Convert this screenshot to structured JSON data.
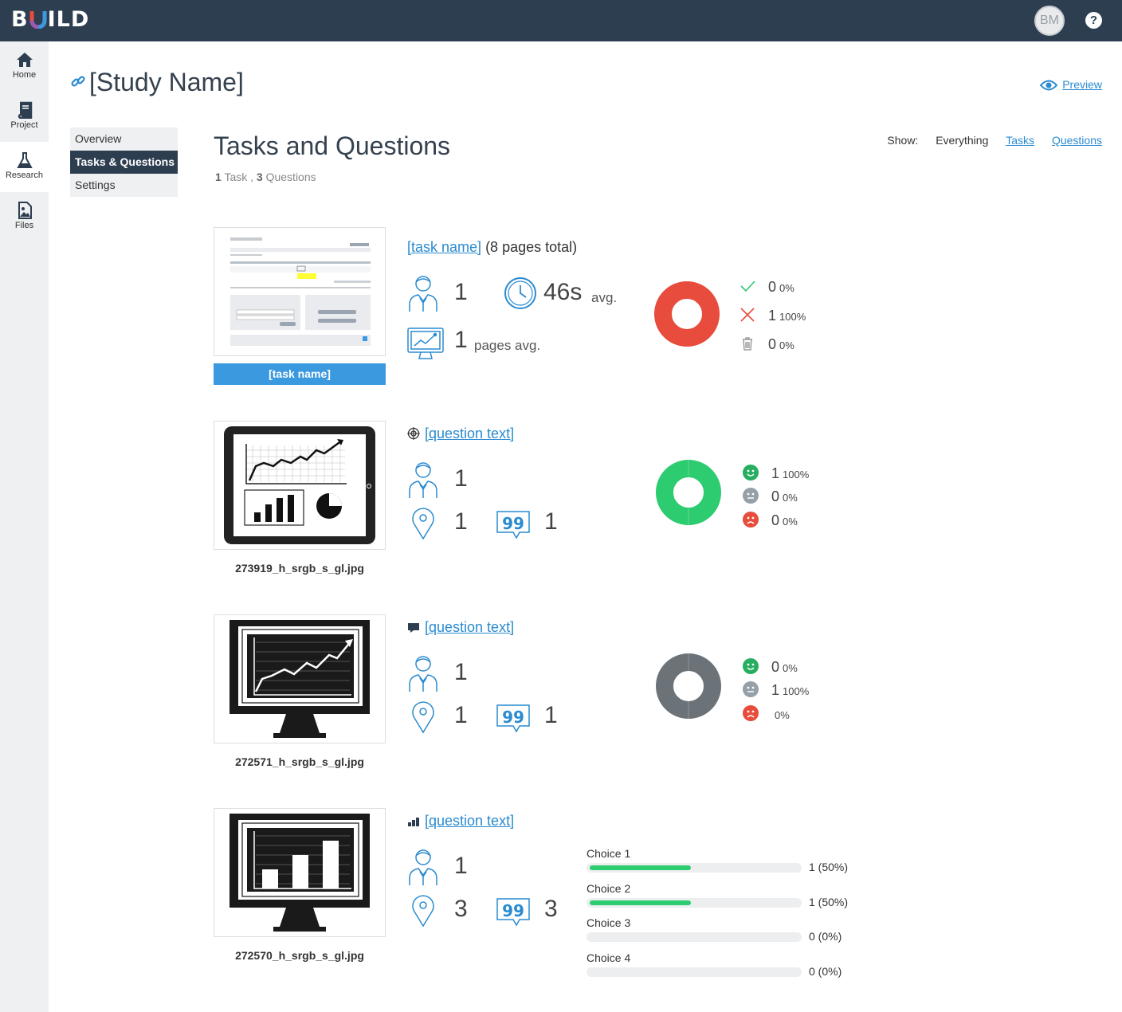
{
  "app": {
    "logo": "BUILD",
    "avatar_initials": "BM",
    "help": "?"
  },
  "rail": [
    {
      "label": "Home",
      "icon": "home-icon"
    },
    {
      "label": "Project",
      "icon": "book-icon"
    },
    {
      "label": "Research",
      "icon": "flask-icon"
    },
    {
      "label": "Files",
      "icon": "image-file-icon"
    }
  ],
  "study": {
    "title": "[Study Name]",
    "preview": "Preview"
  },
  "subnav": [
    "Overview",
    "Tasks & Questions",
    "Settings"
  ],
  "section": {
    "title": "Tasks and Questions",
    "task_count": "1",
    "task_word": "Task ,",
    "question_count": "3",
    "question_word": "Questions"
  },
  "filters": {
    "label": "Show:",
    "everything": "Everything",
    "tasks": "Tasks",
    "questions": "Questions"
  },
  "colors": {
    "accent": "#2a8bd0",
    "topbar": "#2d3e50",
    "success": "#2ecc71",
    "fail": "#e74c3c",
    "neutral": "#6b7379"
  },
  "task": {
    "name_link": "[task name]",
    "suffix": "(8 pages total)",
    "button": "[task name]",
    "participants": "1",
    "time": "46s",
    "time_unit": "avg.",
    "pages": "1",
    "pages_unit": "pages avg.",
    "legend": [
      {
        "icon": "check-icon",
        "count": "0",
        "pct": "0%"
      },
      {
        "icon": "cross-icon",
        "count": "1",
        "pct": "100%"
      },
      {
        "icon": "trash-icon",
        "count": "0",
        "pct": "0%"
      }
    ],
    "donut": {
      "success": 0,
      "fail": 1,
      "abandoned": 0
    }
  },
  "questions": [
    {
      "title": "[question text]",
      "type_icon": "target-icon",
      "file": "273919_h_srgb_s_gl.jpg",
      "participants": "1",
      "pins": "1",
      "comments": "1",
      "legend": [
        {
          "icon": "smile-icon",
          "count": "1",
          "pct": "100%"
        },
        {
          "icon": "neutral-face-icon",
          "count": "0",
          "pct": "0%"
        },
        {
          "icon": "frown-icon",
          "count": "0",
          "pct": "0%"
        }
      ],
      "donut": {
        "positive": 1,
        "neutral": 0,
        "negative": 0
      }
    },
    {
      "title": "[question text]",
      "type_icon": "comment-icon",
      "file": "272571_h_srgb_s_gl.jpg",
      "participants": "1",
      "pins": "1",
      "comments": "1",
      "legend": [
        {
          "icon": "smile-icon",
          "count": "0",
          "pct": "0%"
        },
        {
          "icon": "neutral-face-icon",
          "count": "1",
          "pct": "100%"
        },
        {
          "icon": "frown-icon",
          "count": "",
          "pct": "0%"
        }
      ],
      "donut": {
        "positive": 0,
        "neutral": 1,
        "negative": 0
      }
    },
    {
      "title": "[question text]",
      "type_icon": "bar-chart-icon",
      "file": "272570_h_srgb_s_gl.jpg",
      "participants": "1",
      "pins": "3",
      "comments": "3",
      "choices": [
        {
          "label": "Choice 1",
          "value": "1 (50%)",
          "fraction": 0.5
        },
        {
          "label": "Choice 2",
          "value": "1 (50%)",
          "fraction": 0.5
        },
        {
          "label": "Choice 3",
          "value": "0 (0%)",
          "fraction": 0
        },
        {
          "label": "Choice 4",
          "value": "0 (0%)",
          "fraction": 0
        }
      ]
    }
  ]
}
